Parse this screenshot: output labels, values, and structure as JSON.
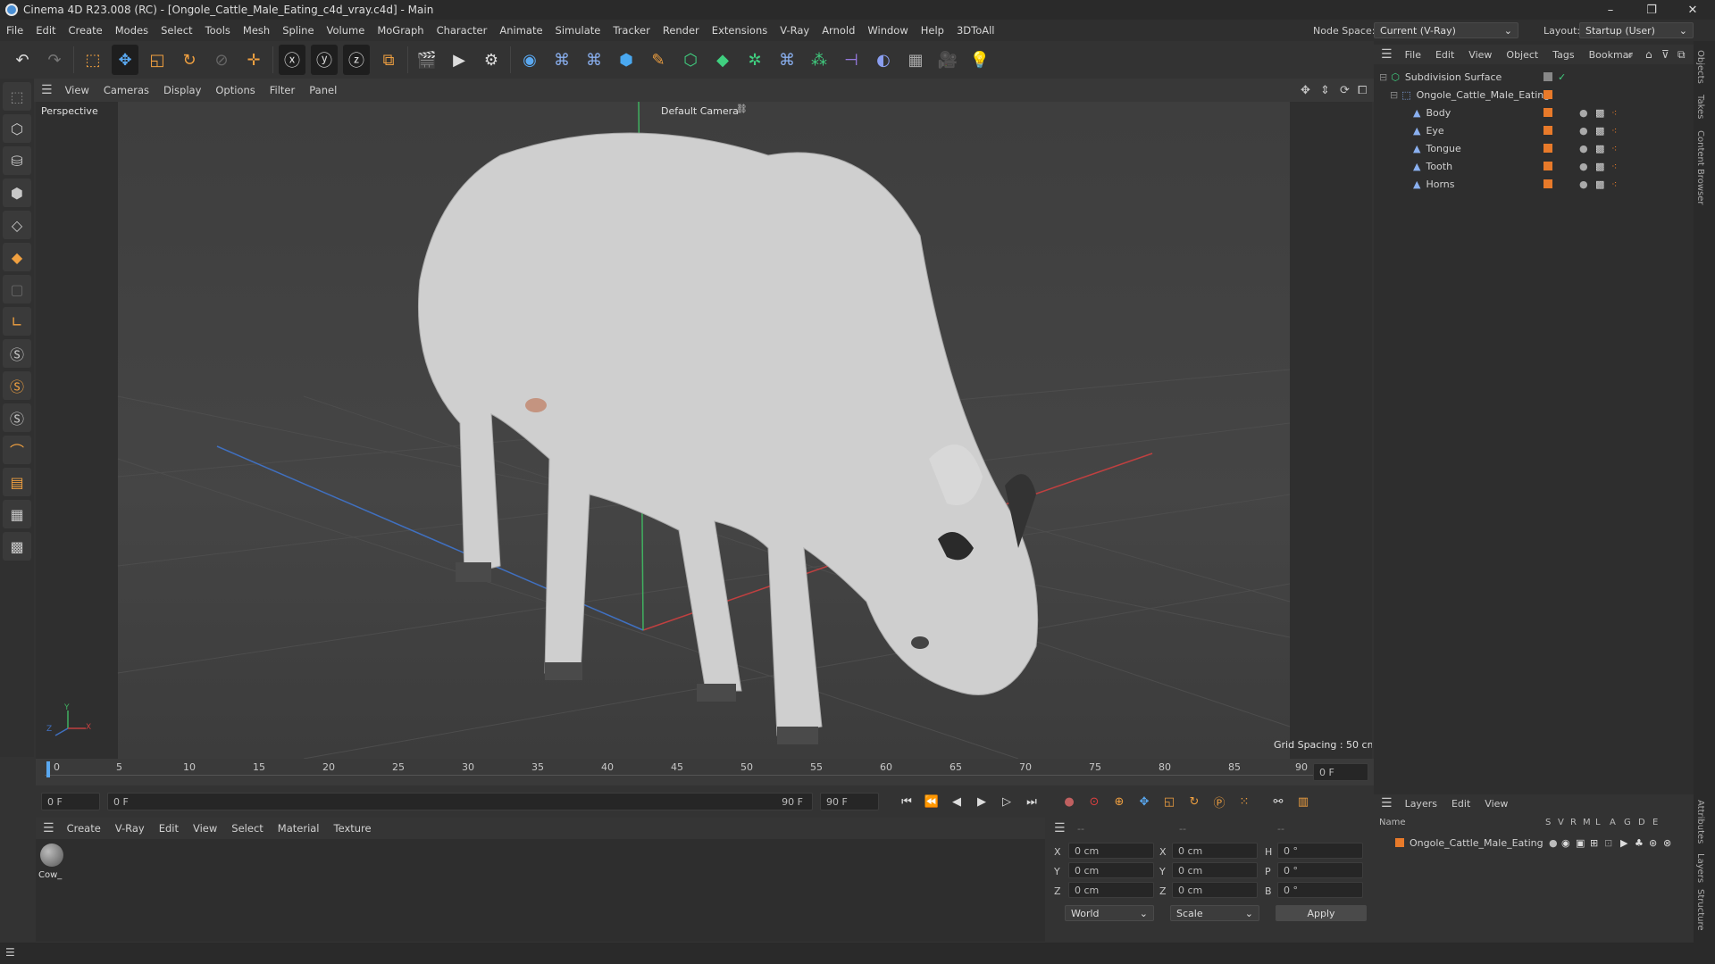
{
  "window": {
    "title": "Cinema 4D R23.008 (RC) - [Ongole_Cattle_Male_Eating_c4d_vray.c4d] - Main",
    "min": "–",
    "max": "❐",
    "close": "✕"
  },
  "menu": [
    "File",
    "Edit",
    "Create",
    "Modes",
    "Select",
    "Tools",
    "Mesh",
    "Spline",
    "Volume",
    "MoGraph",
    "Character",
    "Animate",
    "Simulate",
    "Tracker",
    "Render",
    "Extensions",
    "V-Ray",
    "Arnold",
    "Window",
    "Help",
    "3DToAll"
  ],
  "node_space": {
    "label": "Node Space:",
    "value": "Current (V-Ray)"
  },
  "layout": {
    "label": "Layout:",
    "value": "Startup (User)"
  },
  "viewport": {
    "menu": [
      "View",
      "Cameras",
      "Display",
      "Options",
      "Filter",
      "Panel"
    ],
    "label": "Perspective",
    "camera": "Default Camera",
    "grid_spacing": "Grid Spacing : 50 cm",
    "axis_y": "Y",
    "axis_x": "X",
    "axis_z": "Z"
  },
  "timeline": {
    "ticks": [
      "0",
      "5",
      "10",
      "15",
      "20",
      "25",
      "30",
      "35",
      "40",
      "45",
      "50",
      "55",
      "60",
      "65",
      "70",
      "75",
      "80",
      "85",
      "90"
    ],
    "end_field": "0 F"
  },
  "transport": {
    "start": "0 F",
    "current": "0 F",
    "range_end": "90 F",
    "end": "90 F"
  },
  "material_menu": [
    "Create",
    "V-Ray",
    "Edit",
    "View",
    "Select",
    "Material",
    "Texture"
  ],
  "material": {
    "name": "Cow_"
  },
  "coords": {
    "header_a": "--",
    "header_b": "--",
    "header_c": "--",
    "rows": [
      {
        "axis": "X",
        "pos": "0 cm",
        "axis2": "X",
        "size": "0 cm",
        "axis3": "H",
        "rot": "0 °"
      },
      {
        "axis": "Y",
        "pos": "0 cm",
        "axis2": "Y",
        "size": "0 cm",
        "axis3": "P",
        "rot": "0 °"
      },
      {
        "axis": "Z",
        "pos": "0 cm",
        "axis2": "Z",
        "size": "0 cm",
        "axis3": "B",
        "rot": "0 °"
      }
    ],
    "mode": "World",
    "scale": "Scale",
    "apply": "Apply"
  },
  "objects_menu": [
    "File",
    "Edit",
    "View",
    "Object",
    "Tags",
    "Bookmar"
  ],
  "objects": [
    {
      "name": "Subdivision Surface",
      "indent": 0
    },
    {
      "name": "Ongole_Cattle_Male_Eating",
      "indent": 1
    },
    {
      "name": "Body",
      "indent": 2
    },
    {
      "name": "Eye",
      "indent": 2
    },
    {
      "name": "Tongue",
      "indent": 2
    },
    {
      "name": "Tooth",
      "indent": 2
    },
    {
      "name": "Horns",
      "indent": 2
    }
  ],
  "layers_menu": [
    "Layers",
    "Edit",
    "View"
  ],
  "layers_header": {
    "name": "Name",
    "flags": [
      "S",
      "V",
      "R",
      "M",
      "L",
      "A",
      "G",
      "D",
      "E"
    ]
  },
  "layer_row": "Ongole_Cattle_Male_Eating",
  "vtabs": [
    "Objects",
    "Takes",
    "Content Browser",
    "Attributes",
    "Layers",
    "Structure"
  ],
  "colors": {
    "accent_orange": "#e87a2a",
    "bg_dark": "#2e2e2e",
    "viewport_bg": "#424242",
    "axis_red": "#c04040",
    "axis_blue": "#4070c0",
    "axis_green": "#40b060"
  }
}
